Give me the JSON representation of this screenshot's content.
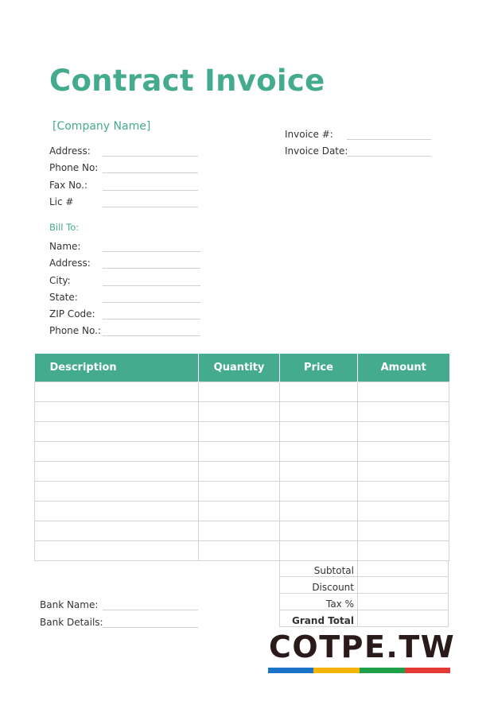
{
  "header": {
    "title": "Contract Invoice",
    "company_name": "[Company Name]"
  },
  "company_fields": [
    "Address:",
    "Phone No:",
    "Fax No.:",
    "Lic #"
  ],
  "invoice_fields": [
    "Invoice #:",
    "Invoice Date:"
  ],
  "bill_to": {
    "heading": "Bill To:",
    "fields": [
      "Name:",
      "Address:",
      "City:",
      "State:",
      "ZIP Code:",
      "Phone No.:"
    ]
  },
  "table": {
    "columns": [
      "Description",
      "Quantity",
      "Price",
      "Amount"
    ],
    "row_count": 9
  },
  "totals": [
    "Subtotal",
    "Discount",
    "Tax %",
    "Grand Total"
  ],
  "bank_fields": [
    "Bank Name:",
    "Bank Details:"
  ],
  "watermark": {
    "text": "COTPE.TW",
    "bar_colors": [
      "#1a73c8",
      "#f5b400",
      "#1fa14a",
      "#e53935"
    ]
  },
  "colors": {
    "accent": "#45ab8e"
  }
}
